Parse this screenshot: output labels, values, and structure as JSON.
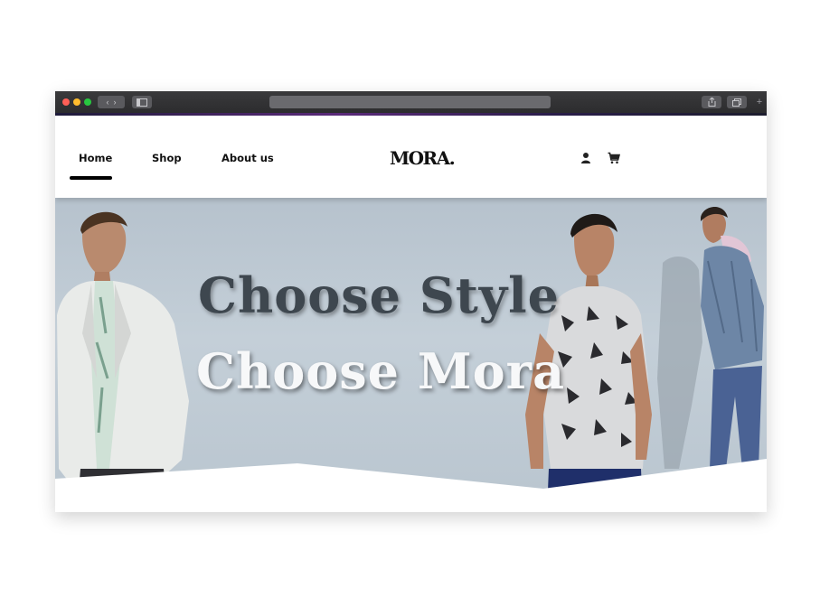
{
  "nav": {
    "links": [
      "Home",
      "Shop",
      "About us"
    ],
    "active": "Home"
  },
  "brand": {
    "logo_text": "MORA."
  },
  "icons": {
    "account": "user-icon",
    "cart": "cart-icon"
  },
  "hero": {
    "headline_1": "Choose Style",
    "headline_2": "Choose Mora"
  },
  "colors": {
    "hero_background": "#bcc7d1",
    "headline_dark": "#3e474f",
    "headline_light": "#f7f8f9",
    "active_underline": "#000000"
  }
}
